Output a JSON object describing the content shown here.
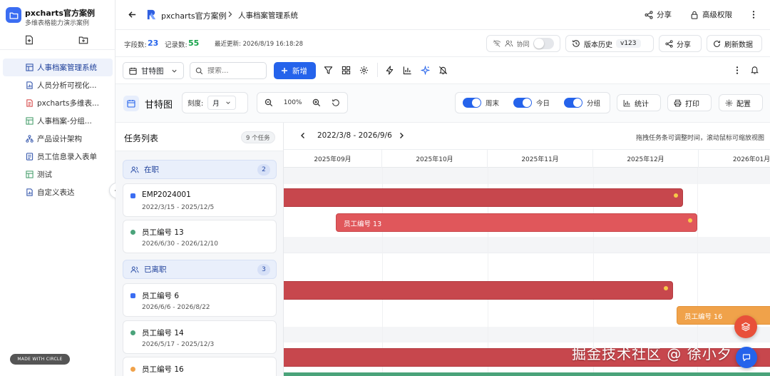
{
  "sidebar": {
    "brand_title": "pxcharts官方案例",
    "brand_subtitle": "多维表格能力演示案例",
    "items": [
      {
        "label": "人事档案管理系统",
        "icon": "table-icon",
        "active": true
      },
      {
        "label": "人员分析可视化...",
        "icon": "doc-chart-icon",
        "active": false
      },
      {
        "label": "pxcharts多维表...",
        "icon": "doc-red-icon",
        "active": false
      },
      {
        "label": "人事档案-分组...",
        "icon": "table-green-icon",
        "active": false
      },
      {
        "label": "产品设计架构",
        "icon": "org-chart-icon",
        "active": false
      },
      {
        "label": "员工信息录入表单",
        "icon": "form-icon",
        "active": false
      },
      {
        "label": "测试",
        "icon": "table-green-icon",
        "active": false
      },
      {
        "label": "自定义表达",
        "icon": "doc-chart-icon",
        "active": false
      }
    ],
    "made_with": "MADE WITH CIRCLE"
  },
  "header": {
    "breadcrumb_root": "pxcharts官方案例",
    "breadcrumb_current": "人事档案管理系统",
    "share_label": "分享",
    "permission_label": "高级权限"
  },
  "infobar": {
    "fields_label": "字段数:",
    "fields_count": "23",
    "records_label": "记录数:",
    "records_count": "55",
    "updated": "最近更新: 2026/8/19 16:18:28",
    "collab_label": "协同",
    "history_label": "版本历史",
    "version": "v123",
    "share_label": "分享",
    "refresh_label": "刷新数据"
  },
  "toolbar": {
    "view_select": "甘特图",
    "search_placeholder": "搜索...",
    "add_label": "新增"
  },
  "gantt": {
    "title": "甘特图",
    "scale_label": "刻度:",
    "scale_value": "月",
    "zoom": "100%",
    "weekend_label": "周末",
    "today_label": "今日",
    "group_label": "分组",
    "stats_label": "统计",
    "print_label": "打印",
    "config_label": "配置",
    "range": "2022/3/8 - 2026/9/6",
    "hint": "拖拽任务条可调整时间，滚动鼠标可缩放视图",
    "months": [
      "2025年09月",
      "2025年10月",
      "2025年11月",
      "2025年12月",
      "2026年01月"
    ]
  },
  "tasklist": {
    "title": "任务列表",
    "count": "9 个任务",
    "groups": [
      {
        "name": "在职",
        "count": "2",
        "tasks": [
          {
            "name": "EMP2024001",
            "dates": "2022/3/15 - 2025/12/5",
            "color": "#3b6df2"
          },
          {
            "name": "员工编号 13",
            "dates": "2026/6/30 - 2026/12/10",
            "color": "#4aa37a"
          }
        ]
      },
      {
        "name": "已离职",
        "count": "3",
        "tasks": [
          {
            "name": "员工编号 6",
            "dates": "2026/6/6 - 2026/8/22",
            "color": "#3b6df2"
          },
          {
            "name": "员工编号 14",
            "dates": "2026/5/17 - 2025/12/3",
            "color": "#4aa37a"
          },
          {
            "name": "员工编号 16",
            "dates": "",
            "color": "#f0a24a"
          }
        ]
      }
    ]
  },
  "bars": {
    "b2_label": "员工编号 13",
    "b4_label": "员工编号 16"
  },
  "watermark": "掘金技术社区 @ 徐小夕"
}
